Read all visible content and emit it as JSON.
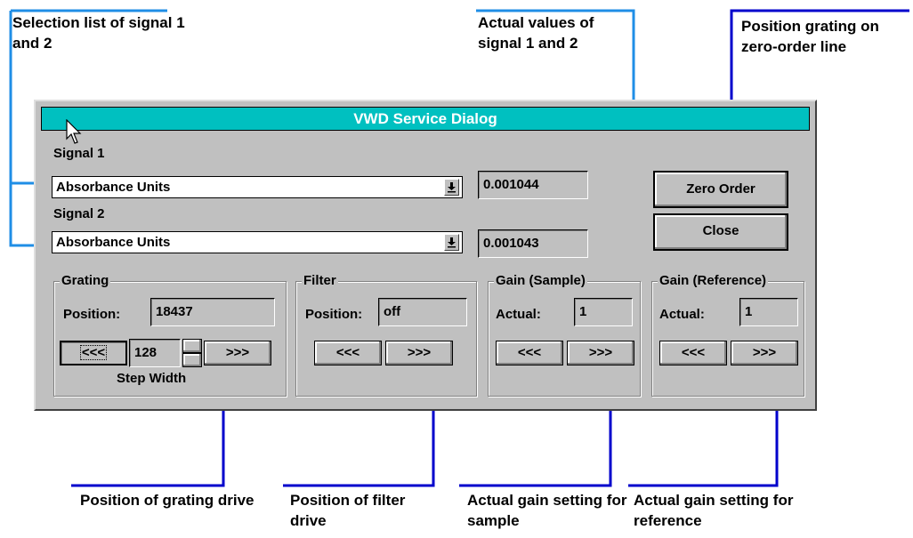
{
  "callouts": {
    "selection_list": "Selection list of signal 1 and 2",
    "actual_values": "Actual values of signal 1 and 2",
    "position_grating": "Position grating on zero-order line",
    "grating_drive": "Position of grating drive",
    "filter_drive": "Position of filter drive",
    "gain_sample": "Actual gain setting for sample",
    "gain_reference": "Actual gain setting for reference"
  },
  "dialog": {
    "title": "VWD Service Dialog",
    "signal1": {
      "label": "Signal 1",
      "value": "Absorbance Units",
      "actual": "0.001044"
    },
    "signal2": {
      "label": "Signal 2",
      "value": "Absorbance Units",
      "actual": "0.001043"
    },
    "buttons": {
      "zero_order": "Zero Order",
      "close": "Close"
    },
    "grating": {
      "title": "Grating",
      "position_label": "Position:",
      "position": "18437",
      "step": "128",
      "step_label": "Step Width",
      "prev": "<<<",
      "next": ">>>"
    },
    "filter": {
      "title": "Filter",
      "position_label": "Position:",
      "position": "off",
      "prev": "<<<",
      "next": ">>>"
    },
    "gain_sample": {
      "title": "Gain (Sample)",
      "actual_label": "Actual:",
      "actual": "1",
      "prev": "<<<",
      "next": ">>>"
    },
    "gain_reference": {
      "title": "Gain (Reference)",
      "actual_label": "Actual:",
      "actual": "1",
      "prev": "<<<",
      "next": ">>>"
    }
  },
  "colors": {
    "callout_line": "#1f8ee6",
    "callout_line_dark": "#0000cc",
    "title_bar": "#00c0c0",
    "dialog_bg": "#c0c0c0"
  },
  "icons": {
    "dropdown": "dropdown-arrow-icon",
    "cursor": "mouse-pointer-icon"
  }
}
